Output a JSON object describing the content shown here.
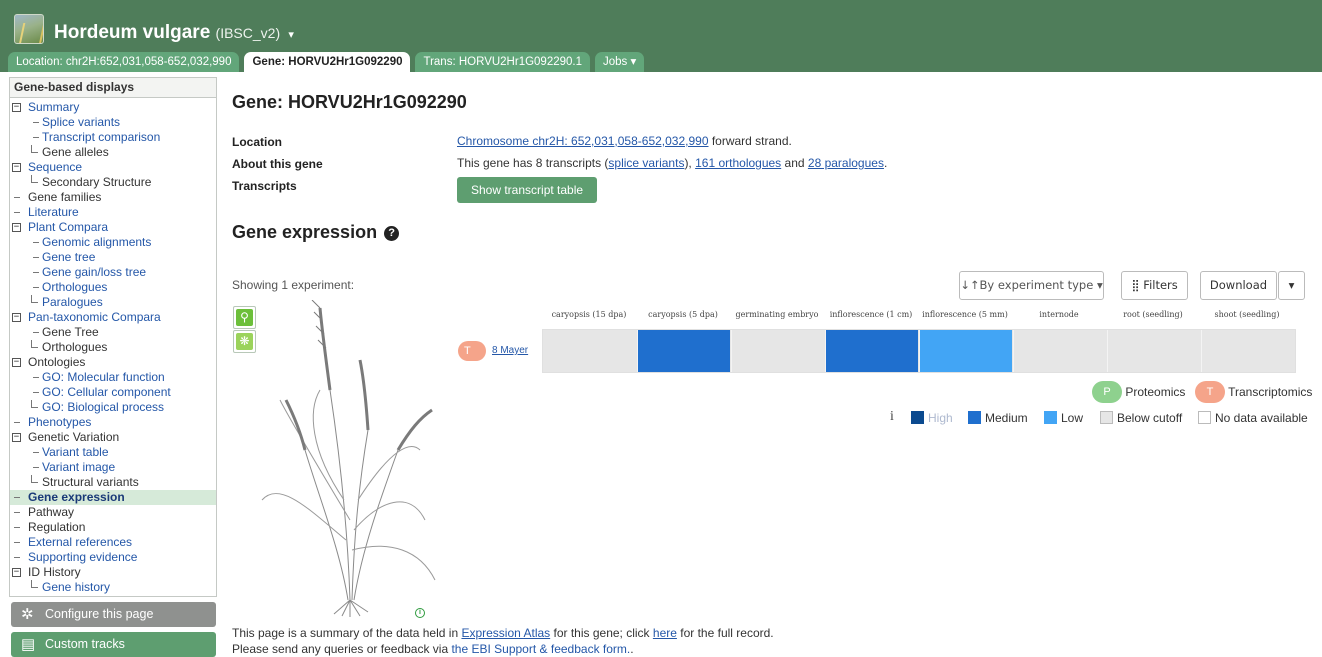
{
  "header": {
    "species": "Hordeum vulgare",
    "assembly": "(IBSC_v2)",
    "caret": "▾"
  },
  "tabs": {
    "location": "Location: chr2H:652,031,058-652,032,990",
    "gene": "Gene: HORVU2Hr1G092290",
    "transcript": "Trans: HORVU2Hr1G092290.1",
    "jobs": "Jobs ▾"
  },
  "sidebar": {
    "heading": "Gene-based displays",
    "items": [
      {
        "label": "Summary",
        "link": true
      },
      {
        "label": "Splice variants",
        "link": true
      },
      {
        "label": "Transcript comparison",
        "link": true
      },
      {
        "label": "Gene alleles",
        "link": false
      },
      {
        "label": "Sequence",
        "link": true
      },
      {
        "label": "Secondary Structure",
        "link": false
      },
      {
        "label": "Gene families",
        "link": false
      },
      {
        "label": "Literature",
        "link": true
      },
      {
        "label": "Plant Compara",
        "link": true
      },
      {
        "label": "Genomic alignments",
        "link": true
      },
      {
        "label": "Gene tree",
        "link": true
      },
      {
        "label": "Gene gain/loss tree",
        "link": true
      },
      {
        "label": "Orthologues",
        "link": true
      },
      {
        "label": "Paralogues",
        "link": true
      },
      {
        "label": "Pan-taxonomic Compara",
        "link": true
      },
      {
        "label": "Gene Tree",
        "link": false
      },
      {
        "label": "Orthologues",
        "link": false
      },
      {
        "label": "Ontologies",
        "link": false
      },
      {
        "label": "GO: Molecular function",
        "link": true
      },
      {
        "label": "GO: Cellular component",
        "link": true
      },
      {
        "label": "GO: Biological process",
        "link": true
      },
      {
        "label": "Phenotypes",
        "link": true
      },
      {
        "label": "Genetic Variation",
        "link": false
      },
      {
        "label": "Variant table",
        "link": true
      },
      {
        "label": "Variant image",
        "link": true
      },
      {
        "label": "Structural variants",
        "link": false
      },
      {
        "label": "Gene expression",
        "link": true,
        "active": true
      },
      {
        "label": "Pathway",
        "link": false
      },
      {
        "label": "Regulation",
        "link": false
      },
      {
        "label": "External references",
        "link": true
      },
      {
        "label": "Supporting evidence",
        "link": true
      },
      {
        "label": "ID History",
        "link": false
      },
      {
        "label": "Gene history",
        "link": true
      }
    ],
    "configure_label": "Configure this page",
    "custom_tracks_label": "Custom tracks"
  },
  "main": {
    "gene_title": "Gene: HORVU2Hr1G092290",
    "summary": {
      "location_label": "Location",
      "location_link": "Chromosome chr2H: 652,031,058-652,032,990",
      "location_suffix": " forward strand.",
      "about_label": "About this gene",
      "about_prefix": "This gene has 8 transcripts (",
      "splice_link": "splice variants",
      "about_mid1": "), ",
      "orthologues_link": "161 orthologues",
      "about_mid2": " and ",
      "paralogues_link": "28 paralogues",
      "about_end": ".",
      "transcripts_label": "Transcripts",
      "show_table_button": "Show transcript table"
    },
    "expression": {
      "heading": "Gene expression",
      "help_glyph": "?",
      "showing": "Showing 1 experiment:",
      "sort_button": "↓↑By experiment type ▾",
      "filters_button": "⣿ Filters",
      "download_button": "Download",
      "download_caret": "▾",
      "anatomy_buttons": [
        "⚲",
        "❋"
      ],
      "info_glyph": "i",
      "columns": [
        "caryopsis (15 dpa)",
        "caryopsis (5 dpa)",
        "germinating embryo",
        "inflorescence (1 cm)",
        "inflorescence (5 mm)",
        "internode",
        "root (seedling)",
        "shoot (seedling)"
      ],
      "experiment": {
        "badge": "T",
        "name": "8 Mayer",
        "levels": [
          "Below cutoff",
          "Medium",
          "Below cutoff",
          "Medium",
          "Low",
          "Below cutoff",
          "Below cutoff",
          "Below cutoff"
        ]
      },
      "type_legend": {
        "proteomics_badge": "P",
        "proteomics": "Proteomics",
        "transcriptomics_badge": "T",
        "transcriptomics": "Transcriptomics"
      },
      "level_legend": {
        "info": "i",
        "high": "High",
        "medium": "Medium",
        "low": "Low",
        "below": "Below cutoff",
        "nodata": "No data available"
      },
      "colors": {
        "High": "#0b4a8f",
        "Medium": "#1f6fce",
        "Low": "#42a5f5",
        "Below cutoff": "#e6e6e6",
        "No data available": "#ffffff"
      }
    },
    "footer": {
      "line1_prefix": "This page is a summary of the data held in ",
      "atlas_link": "Expression Atlas",
      "line1_mid": " for this gene; click ",
      "here_link": "here",
      "line1_end": " for the full record.",
      "line2_prefix": "Please send any queries or feedback via ",
      "ebi_link": "the EBI Support & feedback form.",
      "line2_end": "."
    }
  }
}
